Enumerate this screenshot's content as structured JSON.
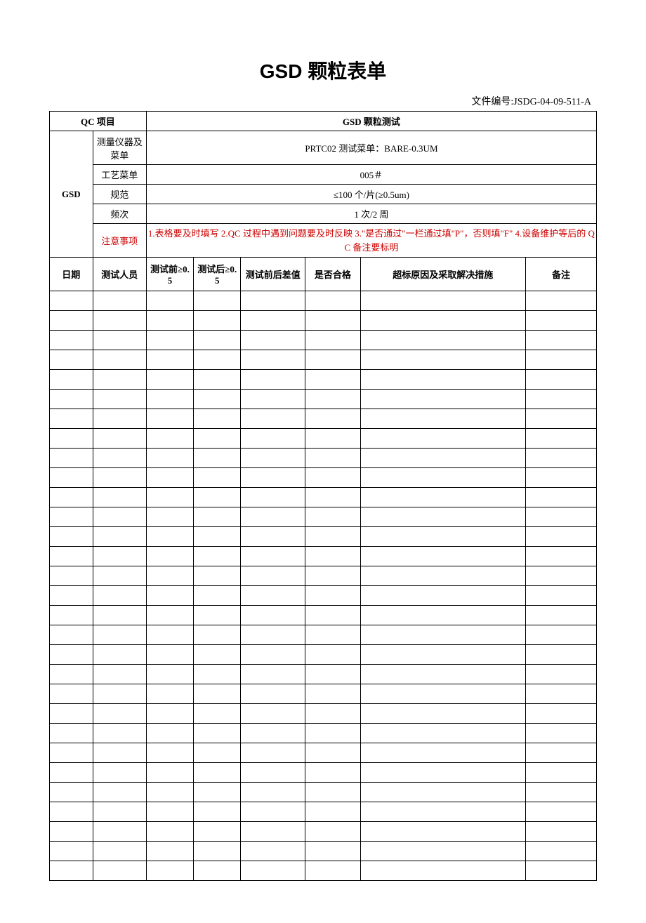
{
  "title": "GSD 颗粒表单",
  "doc_no_label": "文件编号:",
  "doc_no_value": "JSDG-04-09-511-A",
  "header": {
    "qc_project": "QC 项目",
    "test_name": "GSD 颗粒测试",
    "gsd": "GSD",
    "rows": {
      "instrument_label": "测量仪器及菜单",
      "instrument_value": "PRTC02 测试菜单：BARE-0.3UM",
      "process_label": "工艺菜单",
      "process_value": "005＃",
      "spec_label": "规范",
      "spec_value": "≤100 个/片(≥0.5um)",
      "freq_label": "频次",
      "freq_value": "1 次/2 周",
      "notice_label": "注意事项",
      "notice_value": "1.表格要及时填写 2.QC 过程中遇到问题要及时反映 3.\"是否通过\"一栏通过填\"P\"，否则填\"F\" 4.设备维护等后的 QC 备注要标明"
    }
  },
  "columns": {
    "date": "日期",
    "tester": "测试人员",
    "before": "测试前≥0.5",
    "after": "测试后≥0.5",
    "diff": "测试前后差值",
    "pass": "是否合格",
    "reason": "超标原因及采取解决措施",
    "remark": "备注"
  },
  "empty_rows": 30
}
